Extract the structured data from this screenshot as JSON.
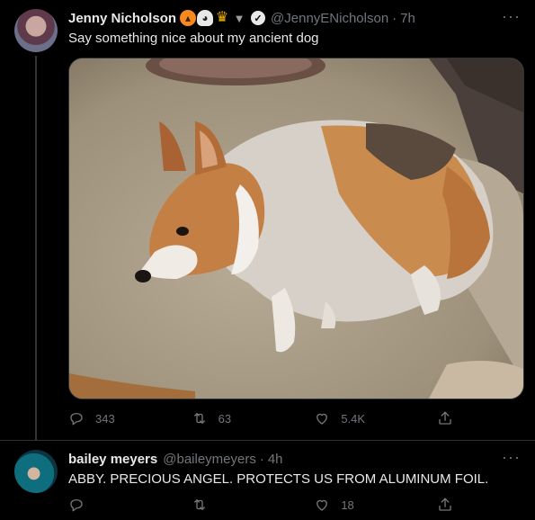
{
  "tweets": [
    {
      "author": {
        "display_name": "Jenny Nicholson",
        "handle": "@JennyENicholson",
        "emoji_icons": [
          "jack-o-lantern",
          "ghost",
          "trophy",
          "bat"
        ],
        "verified": true
      },
      "time": "7h",
      "separator": "·",
      "text": "Say something nice about my ancient dog",
      "media": {
        "description": "photo"
      },
      "actions": {
        "reply_count": "343",
        "retweet_count": "63",
        "like_count": "5.4K"
      }
    },
    {
      "author": {
        "display_name": "bailey meyers",
        "handle": "@baileymeyers"
      },
      "time": "4h",
      "separator": "·",
      "text": "ABBY. PRECIOUS ANGEL. PROTECTS US FROM ALUMINUM FOIL.",
      "actions": {
        "reply_count": "",
        "retweet_count": "",
        "like_count": "18"
      }
    }
  ],
  "more_icon_label": "···",
  "colors": {
    "background": "#000000",
    "text_primary": "#e7e9ea",
    "text_secondary": "#71767b",
    "divider": "#2f3336"
  }
}
